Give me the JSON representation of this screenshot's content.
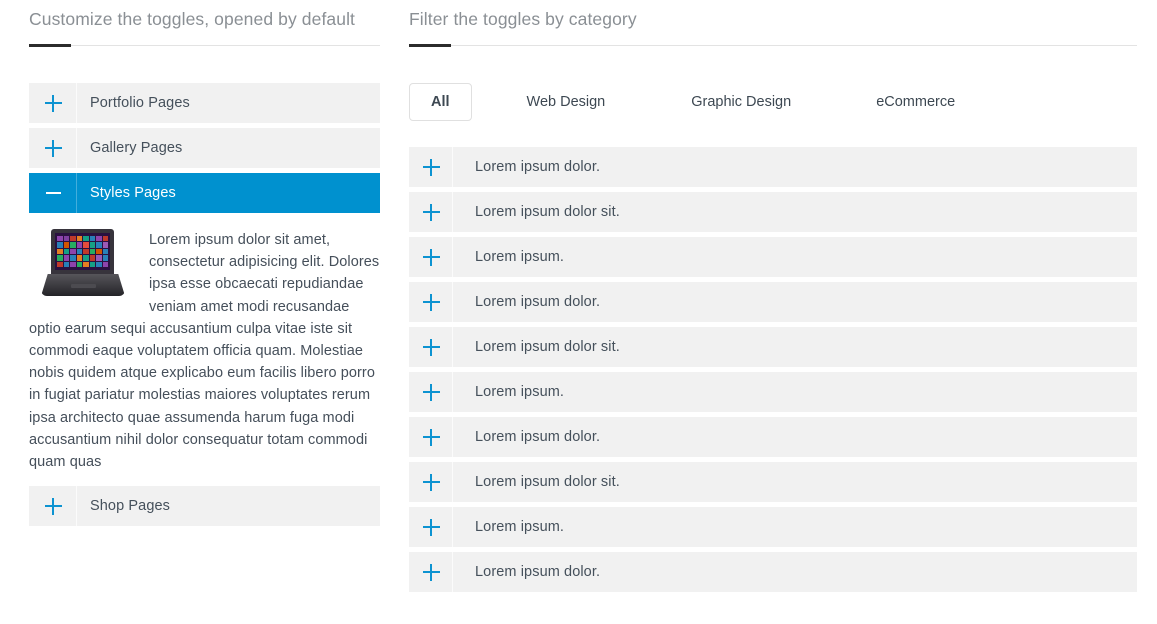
{
  "left": {
    "heading": "Customize the toggles, opened by default",
    "accordion": [
      {
        "label": "Portfolio Pages",
        "icon": "plus-icon",
        "open": false
      },
      {
        "label": "Gallery Pages",
        "icon": "plus-icon",
        "open": false
      },
      {
        "label": "Styles Pages",
        "icon": "minus-icon",
        "open": true
      },
      {
        "label": "Shop Pages",
        "icon": "plus-icon",
        "open": false
      }
    ],
    "panel": {
      "image_alt": "laptop-windows8-thumbnail",
      "text": "Lorem ipsum dolor sit amet, consectetur adipisicing elit. Dolores ipsa esse obcaecati repudiandae veniam amet modi recusandae optio earum sequi accusantium culpa vitae iste sit commodi eaque voluptatem officia quam. Molestiae nobis quidem atque explicabo eum facilis libero porro in fugiat pariatur molestias maiores voluptates rerum ipsa architecto quae assumenda harum fuga modi accusantium nihil dolor consequatur totam commodi quam quas"
    }
  },
  "right": {
    "heading": "Filter the toggles by category",
    "filters": [
      {
        "label": "All",
        "active": true
      },
      {
        "label": "Web Design",
        "active": false
      },
      {
        "label": "Graphic Design",
        "active": false
      },
      {
        "label": "eCommerce",
        "active": false
      }
    ],
    "toggles": [
      {
        "label": "Lorem ipsum dolor.",
        "icon": "plus-icon"
      },
      {
        "label": "Lorem ipsum dolor sit.",
        "icon": "plus-icon"
      },
      {
        "label": "Lorem ipsum.",
        "icon": "plus-icon"
      },
      {
        "label": "Lorem ipsum dolor.",
        "icon": "plus-icon"
      },
      {
        "label": "Lorem ipsum dolor sit.",
        "icon": "plus-icon"
      },
      {
        "label": "Lorem ipsum.",
        "icon": "plus-icon"
      },
      {
        "label": "Lorem ipsum dolor.",
        "icon": "plus-icon"
      },
      {
        "label": "Lorem ipsum dolor sit.",
        "icon": "plus-icon"
      },
      {
        "label": "Lorem ipsum.",
        "icon": "plus-icon"
      },
      {
        "label": "Lorem ipsum dolor.",
        "icon": "plus-icon"
      }
    ]
  },
  "colors": {
    "accent_blue": "#0091cf",
    "icon_blue": "#0d93d1",
    "row_bg": "#f1f1f1",
    "text": "#45505b",
    "heading": "#8a8f94",
    "rule_dark": "#2b2b2b"
  },
  "thumb_tiles": [
    "#8e44ad",
    "#7f3fa0",
    "#c0392b",
    "#e67e22",
    "#16a085",
    "#2980b9",
    "#8e44ad",
    "#c0392b",
    "#2980b9",
    "#d35400",
    "#27ae60",
    "#8e44ad",
    "#e74c3c",
    "#16a085",
    "#2980b9",
    "#9b59b6",
    "#e67e22",
    "#16a085",
    "#8e44ad",
    "#2980b9",
    "#c0392b",
    "#27ae60",
    "#d35400",
    "#2980b9",
    "#27ae60",
    "#8e44ad",
    "#2980b9",
    "#e67e22",
    "#16a085",
    "#c0392b",
    "#9b59b6",
    "#2980b9",
    "#c0392b",
    "#2980b9",
    "#8e44ad",
    "#27ae60",
    "#e67e22",
    "#16a085",
    "#2980b9",
    "#8e44ad"
  ]
}
